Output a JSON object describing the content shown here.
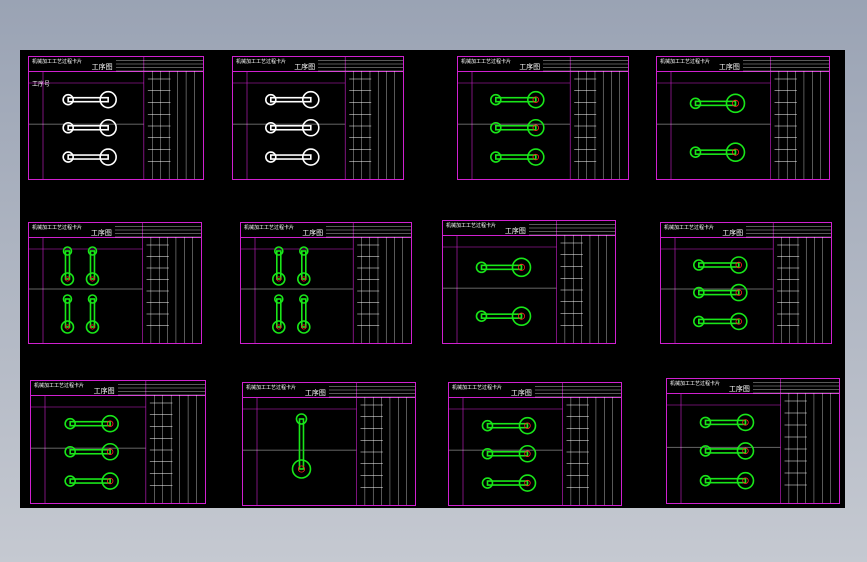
{
  "window": {
    "title": ""
  },
  "drawing": {
    "sheet_header": "机械加工工艺过程卡片",
    "sheet_title": "工序图",
    "sheet_label": "工序号",
    "sheets": [
      {
        "id": 1,
        "highlight": false
      },
      {
        "id": 2,
        "highlight": false
      },
      {
        "id": 3,
        "highlight": true
      },
      {
        "id": 4,
        "highlight": true
      },
      {
        "id": 5,
        "highlight": true
      },
      {
        "id": 6,
        "highlight": true
      },
      {
        "id": 7,
        "highlight": true
      },
      {
        "id": 8,
        "highlight": true
      },
      {
        "id": 9,
        "highlight": true
      },
      {
        "id": 10,
        "highlight": true
      },
      {
        "id": 11,
        "highlight": true
      },
      {
        "id": 12,
        "highlight": true
      }
    ]
  },
  "colors": {
    "background_top": "#9aa3b4",
    "viewport": "#000000",
    "sheet_border": "#d020d0",
    "part": "#19e619",
    "highlight": "#ff2020"
  }
}
